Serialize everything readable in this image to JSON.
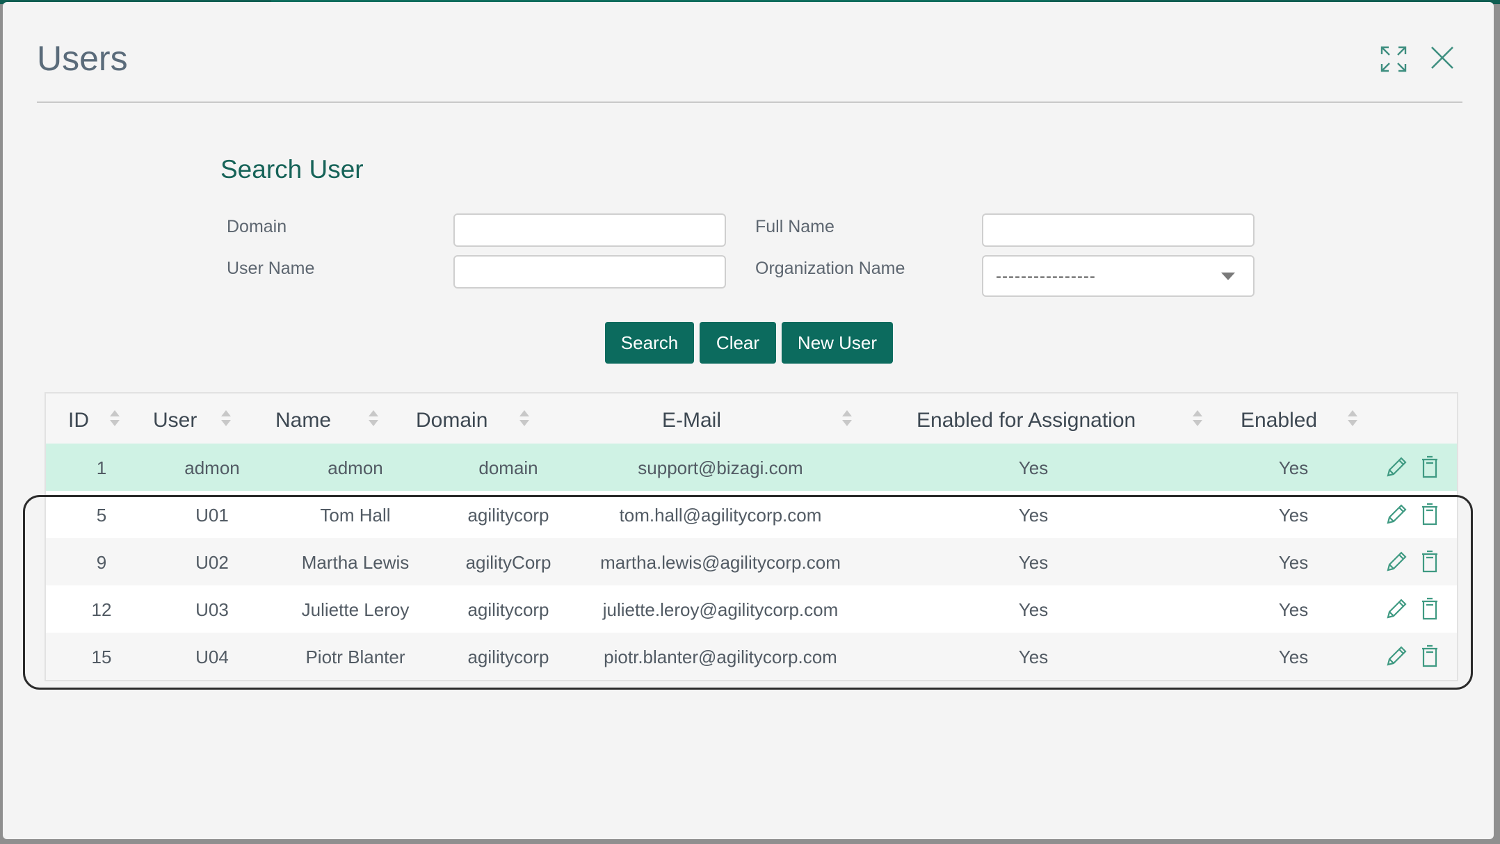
{
  "dialog": {
    "title": "Users"
  },
  "search": {
    "heading": "Search User",
    "domain_label": "Domain",
    "domain_value": "",
    "username_label": "User Name",
    "username_value": "",
    "fullname_label": "Full Name",
    "fullname_value": "",
    "org_label": "Organization Name",
    "org_selected": "----------------"
  },
  "buttons": {
    "search": "Search",
    "clear": "Clear",
    "new_user": "New User"
  },
  "table": {
    "columns": [
      "ID",
      "User",
      "Name",
      "Domain",
      "E-Mail",
      "Enabled for Assignation",
      "Enabled"
    ],
    "rows": [
      [
        "1",
        "admon",
        "admon",
        "domain",
        "support@bizagi.com",
        "Yes",
        "Yes"
      ],
      [
        "5",
        "U01",
        "Tom Hall",
        "agilitycorp",
        "tom.hall@agilitycorp.com",
        "Yes",
        "Yes"
      ],
      [
        "9",
        "U02",
        "Martha Lewis",
        "agilityCorp",
        "martha.lewis@agilitycorp.com",
        "Yes",
        "Yes"
      ],
      [
        "12",
        "U03",
        "Juliette Leroy",
        "agilitycorp",
        "juliette.leroy@agilitycorp.com",
        "Yes",
        "Yes"
      ],
      [
        "15",
        "U04",
        "Piotr Blanter",
        "agilitycorp",
        "piotr.blanter@agilitycorp.com",
        "Yes",
        "Yes"
      ]
    ]
  },
  "colors": {
    "accent": "#0c6b5e",
    "selected_row": "#cff2e4",
    "heading": "#166358"
  },
  "icons": {
    "maximize": "maximize-icon",
    "close": "close-icon",
    "edit": "pencil-icon",
    "delete": "trash-icon"
  }
}
